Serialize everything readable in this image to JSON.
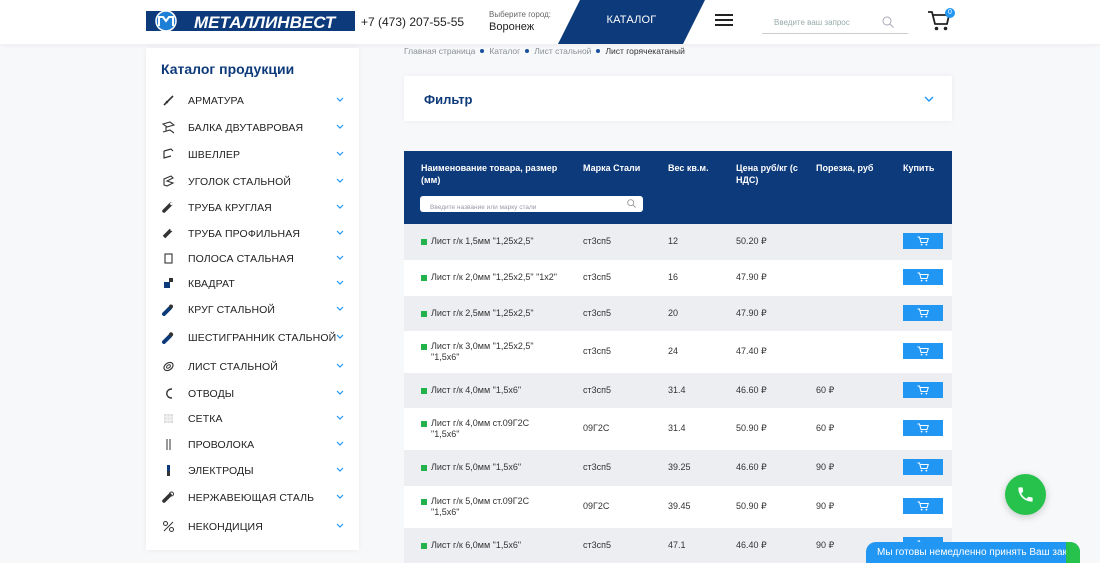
{
  "header": {
    "logo_text": "МЕТАЛЛИНВЕСТ",
    "phone": "+7 (473) 207-55-55",
    "city_label": "Выберите город:",
    "city": "Воронеж",
    "catalog_label": "КАТАЛОГ",
    "search_placeholder": "Введите ваш запрос",
    "cart_count": "0"
  },
  "sidebar": {
    "title": "Каталог продукции",
    "items": [
      {
        "label": "АРМАТУРА",
        "icon": "rebar-icon"
      },
      {
        "label": "БАЛКА ДВУТАВРОВАЯ",
        "icon": "i-beam-icon"
      },
      {
        "label": "ШВЕЛЛЕР",
        "icon": "channel-icon"
      },
      {
        "label": "УГОЛОК СТАЛЬНОЙ",
        "icon": "angle-icon"
      },
      {
        "label": "ТРУБА КРУГЛАЯ",
        "icon": "round-pipe-icon"
      },
      {
        "label": "ТРУБА ПРОФИЛЬНАЯ",
        "icon": "profile-pipe-icon"
      },
      {
        "label": "ПОЛОСА СТАЛЬНАЯ",
        "icon": "strip-icon"
      },
      {
        "label": "КВАДРАТ",
        "icon": "square-bar-icon"
      },
      {
        "label": "КРУГ СТАЛЬНОЙ",
        "icon": "round-bar-icon"
      },
      {
        "label": "ШЕСТИГРАННИК СТАЛЬНОЙ",
        "icon": "hexagon-bar-icon"
      },
      {
        "label": "ЛИСТ СТАЛЬНОЙ",
        "icon": "sheet-icon"
      },
      {
        "label": "ОТВОДЫ",
        "icon": "elbow-icon"
      },
      {
        "label": "СЕТКА",
        "icon": "mesh-icon"
      },
      {
        "label": "ПРОВОЛОКА",
        "icon": "wire-icon"
      },
      {
        "label": "ЭЛЕКТРОДЫ",
        "icon": "electrode-icon"
      },
      {
        "label": "НЕРЖАВЕЮЩАЯ СТАЛЬ",
        "icon": "stainless-icon"
      },
      {
        "label": "НЕКОНДИЦИЯ",
        "icon": "percent-icon"
      }
    ]
  },
  "breadcrumb": {
    "items": [
      "Главная страница",
      "Каталог",
      "Лист стальной"
    ],
    "current": "Лист горячекатаный"
  },
  "filter": {
    "title": "Фильтр"
  },
  "table": {
    "headers": {
      "name": "Наименование товара, размер (мм)",
      "grade": "Марка Стали",
      "weight": "Вес кв.м.",
      "price": "Цена руб/кг (с НДС)",
      "cut": "Порезка, руб",
      "buy": "Купить"
    },
    "search_placeholder": "Введите название или марку стали",
    "rows": [
      {
        "name": "Лист г/к 1,5мм \"1,25х2,5\"",
        "grade": "ст3сп5",
        "weight": "12",
        "price": "50.20 ₽",
        "cut": ""
      },
      {
        "name": "Лист г/к 2,0мм \"1,25х2,5\" \"1х2\"",
        "grade": "ст3сп5",
        "weight": "16",
        "price": "47.90 ₽",
        "cut": ""
      },
      {
        "name": "Лист г/к 2,5мм \"1,25х2,5\"",
        "grade": "ст3сп5",
        "weight": "20",
        "price": "47.90 ₽",
        "cut": ""
      },
      {
        "name": "Лист г/к 3,0мм \"1,25х2,5\"\n\"1,5х6\"",
        "grade": "ст3сп5",
        "weight": "24",
        "price": "47.40 ₽",
        "cut": ""
      },
      {
        "name": "Лист г/к 4,0мм \"1,5х6\"",
        "grade": "ст3сп5",
        "weight": "31.4",
        "price": "46.60 ₽",
        "cut": "60 ₽"
      },
      {
        "name": "Лист г/к 4,0мм ст.09Г2С\n\"1,5х6\"",
        "grade": "09Г2С",
        "weight": "31.4",
        "price": "50.90 ₽",
        "cut": "60 ₽"
      },
      {
        "name": "Лист г/к 5,0мм \"1,5х6\"",
        "grade": "ст3сп5",
        "weight": "39.25",
        "price": "46.60 ₽",
        "cut": "90 ₽"
      },
      {
        "name": "Лист г/к 5,0мм ст.09Г2С\n\"1,5х6\"",
        "grade": "09Г2С",
        "weight": "39.45",
        "price": "50.90 ₽",
        "cut": "90 ₽"
      },
      {
        "name": "Лист г/к 6,0мм \"1,5х6\"",
        "grade": "ст3сп5",
        "weight": "47.1",
        "price": "46.40 ₽",
        "cut": "90 ₽"
      }
    ]
  },
  "chat": {
    "text": "Мы готовы немедленно принять Ваш заказ"
  },
  "colors": {
    "brand": "#0d3a7a",
    "accent": "#2196f3",
    "green": "#27c24c"
  }
}
